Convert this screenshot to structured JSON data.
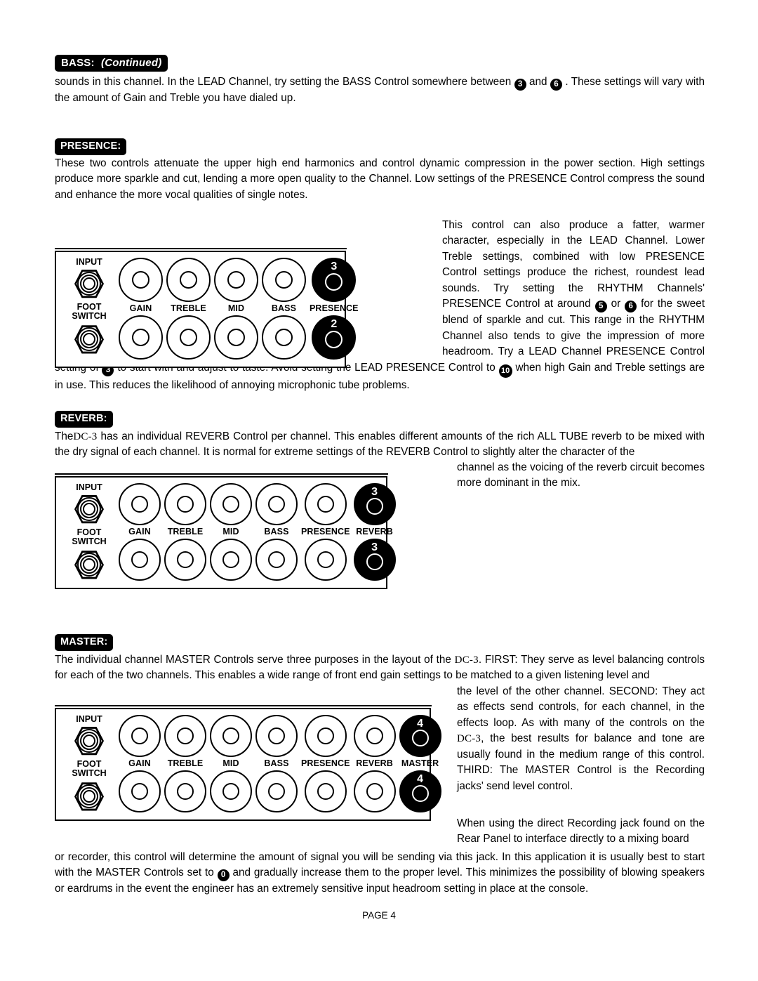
{
  "document": {
    "footer": "PAGE 4"
  },
  "sections": {
    "bass": {
      "heading": "BASS:",
      "heading_suffix": "(Continued)",
      "body_a": "sounds in this channel. In the LEAD Channel, try setting the BASS Control somewhere between",
      "badge_1": "3",
      "body_b": "and",
      "badge_2": "6",
      "body_c": ". These settings will vary with the amount of Gain and Treble you have dialed up."
    },
    "presence": {
      "heading": "PRESENCE:",
      "para1": "These two controls attenuate the upper high end harmonics and control dynamic compression in the power section. High settings produce more sparkle and cut, lending a more open quality to the Channel. Low settings of the PRESENCE Control compress the sound and enhance the more vocal qualities of single notes.",
      "para2_a": "This control can also produce a fatter, warmer character, especially in the LEAD Channel. Lower Treble settings, combined with low PRESENCE Control settings produce the richest, roundest lead sounds. Try setting the RHYTHM Channels' PRESENCE Control at around",
      "badge_1": "5",
      "para2_b": "or",
      "badge_2": "6",
      "para2_c": "for the sweet blend of sparkle and cut. This range in the RHYTHM Channel also tends to give the impression of more headroom. Try a LEAD Channel PRESENCE Control setting of",
      "badge_3": "3",
      "para2_d": "to start with and adjust to taste. Avoid setting the LEAD PRESENCE Control to",
      "badge_4": "10",
      "para2_e": "when high Gain and Treble settings are in use. This reduces the likelihood of annoying microphonic tube problems."
    },
    "reverb": {
      "heading": "REVERB:",
      "para_a": "The",
      "model": "DC-3",
      "para_b": "has an individual REVERB Control per channel. This enables different amounts of the rich ALL TUBE reverb to be mixed with the dry signal of each channel. It is normal for extreme settings of the REVERB Control to slightly alter the character of the",
      "para_side": "channel as the voicing of the reverb circuit becomes more dominant in the mix."
    },
    "master": {
      "heading": "MASTER:",
      "para_a": "The individual channel MASTER Controls serve three purposes in the layout of the",
      "model": "DC-3",
      "para_b": ". FIRST:  They serve as level balancing controls for each of the two channels. This enables a wide range of front end gain settings to be matched to a given listening level and",
      "side_a": "the level of the other channel. SECOND: They act as effects send controls, for each channel, in the effects loop. As with many of the controls on the",
      "side_model": "DC-3",
      "side_b": ", the best results for balance and tone are usually found in the medium range of this control. THIRD:  The MASTER Control is the Recording jacks' send level control.",
      "side_c": "When using the direct Recording jack found on the Rear Panel to interface directly to a mixing board",
      "bottom_a": "or recorder, this control will determine the amount of signal you will be sending via this jack. In this application it is usually best to start with the MASTER Controls set to",
      "bottom_badge": "0",
      "bottom_b": "and gradually increase them to the proper level. This minimizes the possibility of blowing speakers or eardrums in the event the engineer has an extremely sensitive input headroom setting in place at the console."
    }
  },
  "panels": [
    {
      "id": "presence-panel",
      "jack_labels": {
        "top": "INPUT",
        "bottom": "FOOT\nSWITCH"
      },
      "knobs": [
        "GAIN",
        "TREBLE",
        "MID",
        "BASS",
        "PRESENCE"
      ],
      "highlight": "PRESENCE",
      "values": {
        "top": "3",
        "bottom": "2"
      }
    },
    {
      "id": "reverb-panel",
      "jack_labels": {
        "top": "INPUT",
        "bottom": "FOOT\nSWITCH"
      },
      "knobs": [
        "GAIN",
        "TREBLE",
        "MID",
        "BASS",
        "PRESENCE",
        "REVERB"
      ],
      "highlight": "REVERB",
      "values": {
        "top": "3",
        "bottom": "3"
      }
    },
    {
      "id": "master-panel",
      "jack_labels": {
        "top": "INPUT",
        "bottom": "FOOT\nSWITCH"
      },
      "knobs": [
        "GAIN",
        "TREBLE",
        "MID",
        "BASS",
        "PRESENCE",
        "REVERB",
        "MASTER"
      ],
      "highlight": "MASTER",
      "values": {
        "top": "4",
        "bottom": "4"
      }
    }
  ]
}
